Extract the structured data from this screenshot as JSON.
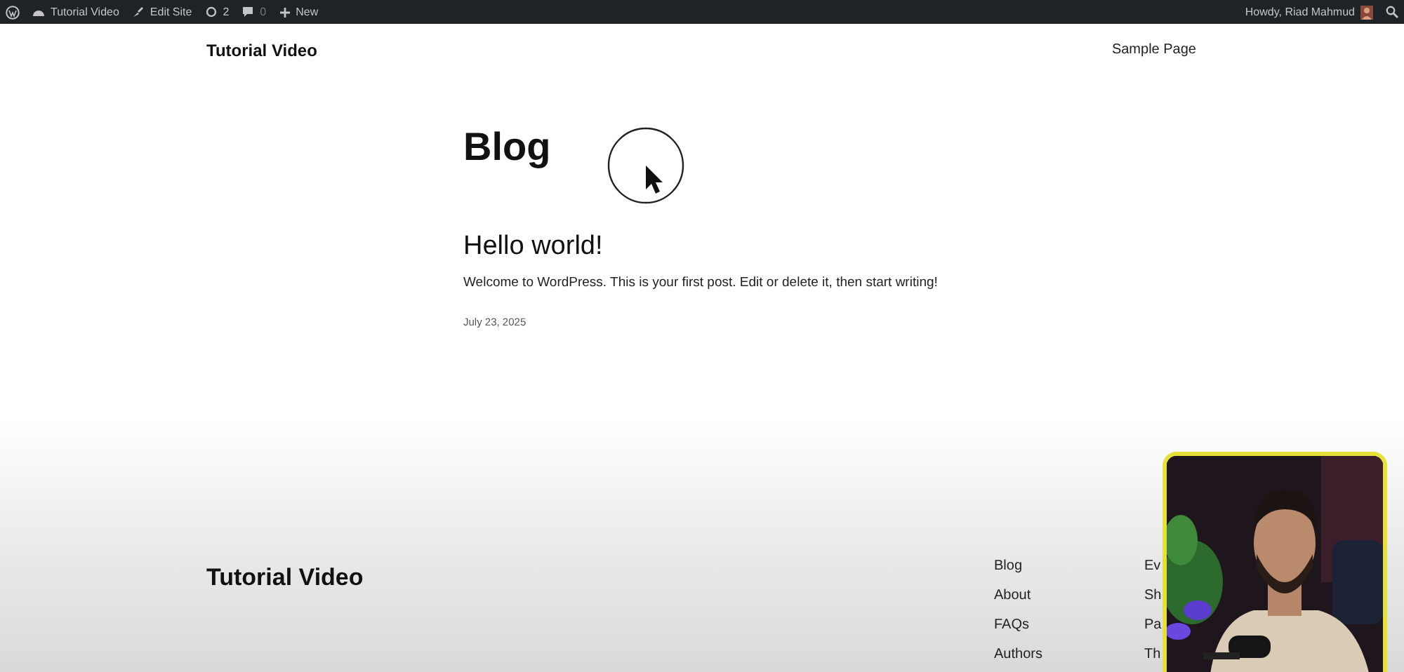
{
  "admin_bar": {
    "site": "Tutorial Video",
    "edit": "Edit Site",
    "updates": "2",
    "comments": "0",
    "new": "New",
    "greeting": "Howdy, Riad Mahmud"
  },
  "header": {
    "site_title": "Tutorial Video",
    "nav": [
      "Sample Page"
    ]
  },
  "page_title": "Blog",
  "posts": [
    {
      "title": "Hello world!",
      "excerpt": "Welcome to WordPress. This is your first post. Edit or delete it, then start writing!",
      "date": "July 23, 2025"
    }
  ],
  "footer": {
    "site_title": "Tutorial Video",
    "columns": [
      [
        "Blog",
        "About",
        "FAQs",
        "Authors"
      ],
      [
        "Ev",
        "Sh",
        "Pa",
        "Th"
      ]
    ]
  }
}
